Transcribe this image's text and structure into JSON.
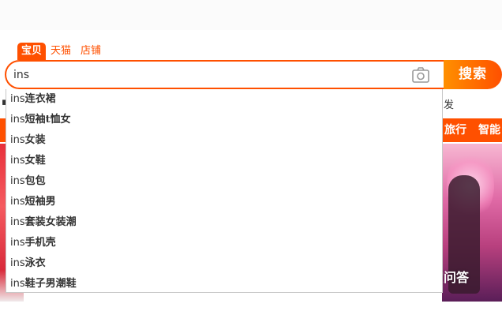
{
  "tabs": [
    {
      "label": "宝贝",
      "active": true
    },
    {
      "label": "天猫",
      "active": false
    },
    {
      "label": "店铺",
      "active": false
    }
  ],
  "search": {
    "value": "ins",
    "button_label": "搜索",
    "camera_icon": "camera-icon"
  },
  "suggestions": [
    {
      "prefix": "ins",
      "rest": "连衣裙"
    },
    {
      "prefix": "ins",
      "rest": "短袖t恤女"
    },
    {
      "prefix": "ins",
      "rest": "女装"
    },
    {
      "prefix": "ins",
      "rest": "女鞋"
    },
    {
      "prefix": "ins",
      "rest": "包包"
    },
    {
      "prefix": "ins",
      "rest": "短袖男"
    },
    {
      "prefix": "ins",
      "rest": "套装女装潮"
    },
    {
      "prefix": "ins",
      "rest": "手机壳"
    },
    {
      "prefix": "ins",
      "rest": "泳衣"
    },
    {
      "prefix": "ins",
      "rest": "鞋子男潮鞋"
    }
  ],
  "background": {
    "hot_word_tail": "发",
    "categories": [
      "旅行",
      "智能"
    ],
    "watermark": "悟空问答"
  },
  "colors": {
    "accent": "#ff5000",
    "accent_light": "#ff9000"
  }
}
